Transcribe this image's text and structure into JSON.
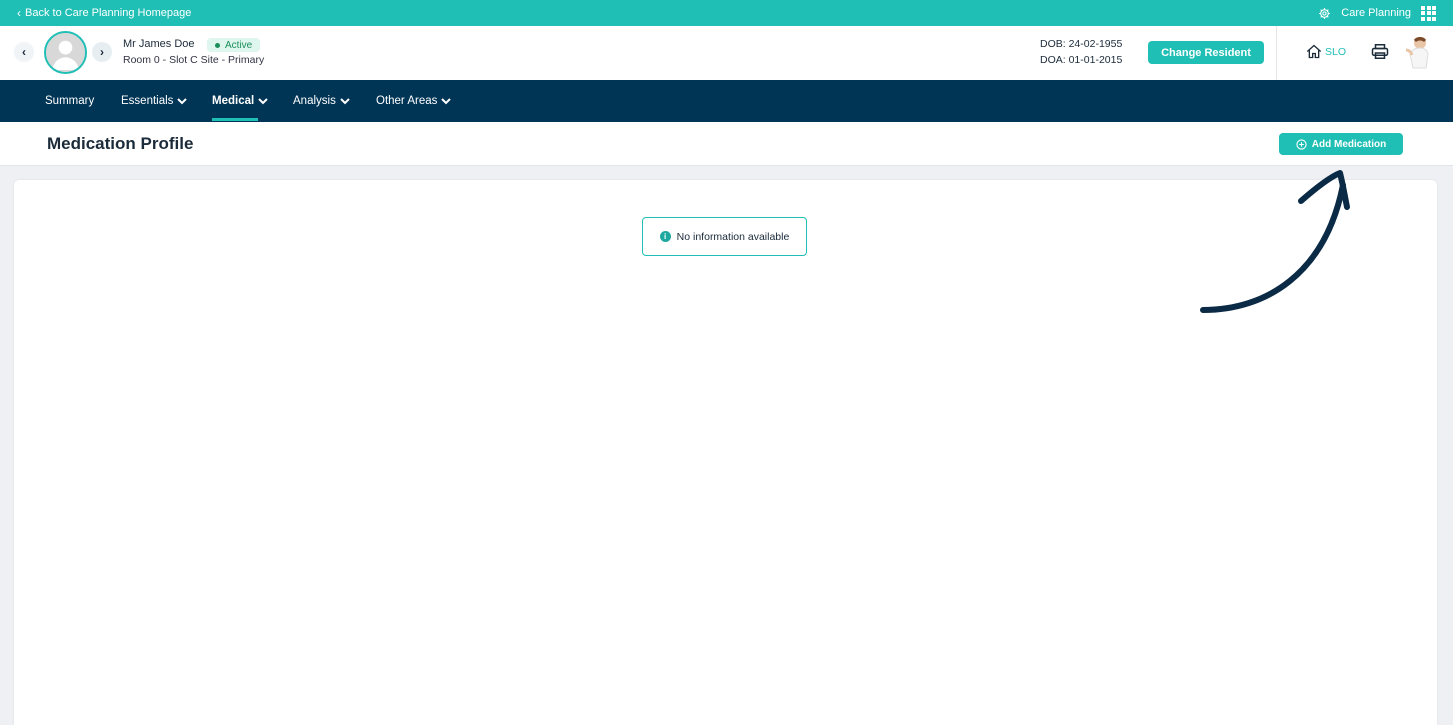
{
  "topbar": {
    "back_label": "Back to Care Planning Homepage",
    "app_name": "Care Planning"
  },
  "resident": {
    "name": "Mr James Doe",
    "status": "Active",
    "room": "Room 0 - Slot C Site - Primary",
    "dob": "DOB: 24-02-1955",
    "doa": "DOA: 01-01-2015",
    "change_label": "Change Resident",
    "home_label": "SLO"
  },
  "nav": {
    "items": [
      {
        "label": "Summary",
        "dropdown": false
      },
      {
        "label": "Essentials",
        "dropdown": true
      },
      {
        "label": "Medical",
        "dropdown": true,
        "active": true
      },
      {
        "label": "Analysis",
        "dropdown": true
      },
      {
        "label": "Other Areas",
        "dropdown": true
      }
    ]
  },
  "page": {
    "title": "Medication Profile",
    "add_label": "Add Medication",
    "empty_message": "No information available"
  },
  "colors": {
    "teal": "#20bfb5",
    "navy": "#003556",
    "annotation": "#0b2a45"
  },
  "icons": {
    "back": "chevron-left-icon",
    "settings": "gear-icon",
    "apps": "apps-grid-icon",
    "home": "home-icon",
    "print": "printer-icon",
    "add": "plus-circle-icon",
    "info": "info-icon"
  }
}
